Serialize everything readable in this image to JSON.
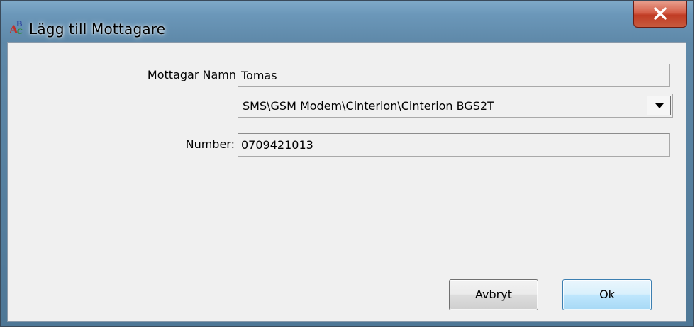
{
  "window": {
    "title": "Lägg till Mottagare",
    "close_glyph": "X"
  },
  "form": {
    "name_label": "Mottagar Namn",
    "name_value": "Tomas",
    "device_selected": "SMS\\GSM Modem\\Cinterion\\Cinterion BGS2T",
    "number_label": "Number:",
    "number_value": "0709421013"
  },
  "buttons": {
    "cancel_label": "Avbryt",
    "ok_label": "Ok"
  },
  "icons": {
    "app": "abc-spell-icon",
    "close": "close-icon",
    "dropdown": "chevron-down-icon"
  },
  "colors": {
    "titlebar": "#6b97b9",
    "client_bg": "#f0f0f0",
    "close_button": "#c75a3e"
  }
}
